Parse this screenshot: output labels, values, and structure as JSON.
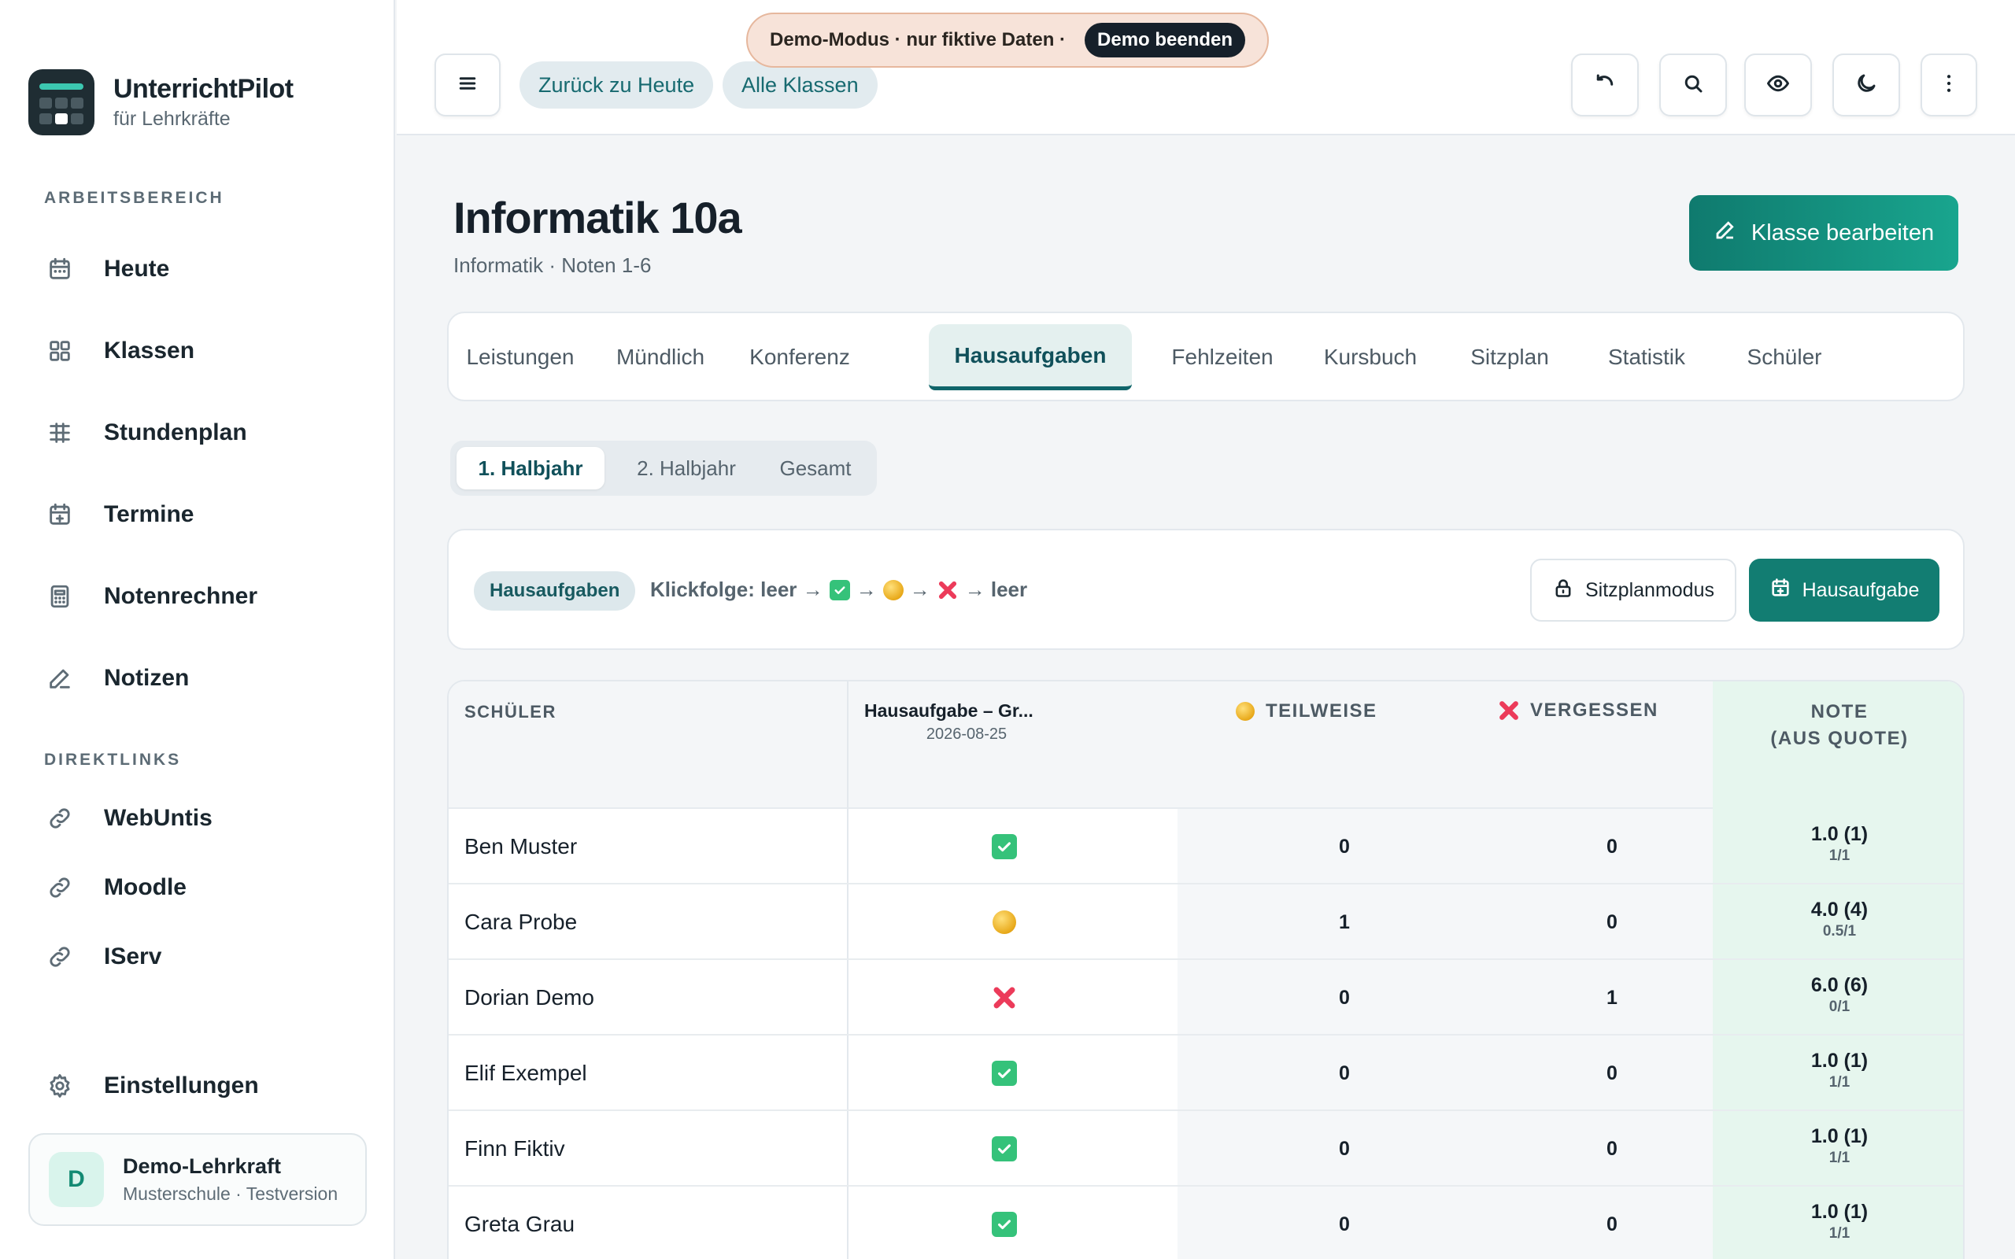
{
  "brand": {
    "title": "UnterrichtPilot",
    "subtitle": "für Lehrkräfte"
  },
  "sidebar": {
    "section_workspace": "ARBEITSBEREICH",
    "items": [
      {
        "label": "Heute",
        "icon": "calendar-icon"
      },
      {
        "label": "Klassen",
        "icon": "grid-icon"
      },
      {
        "label": "Stundenplan",
        "icon": "timetable-icon"
      },
      {
        "label": "Termine",
        "icon": "calendar-plus-icon"
      },
      {
        "label": "Notenrechner",
        "icon": "calculator-icon"
      },
      {
        "label": "Notizen",
        "icon": "pencil-icon"
      }
    ],
    "section_links": "DIREKTLINKS",
    "links": [
      {
        "label": "WebUntis",
        "icon": "link-icon"
      },
      {
        "label": "Moodle",
        "icon": "link-icon"
      },
      {
        "label": "IServ",
        "icon": "link-icon"
      }
    ],
    "settings_label": "Einstellungen",
    "profile": {
      "initial": "D",
      "name": "Demo-Lehrkraft",
      "sub": "Musterschule · Testversion"
    }
  },
  "topbar": {
    "demo_text": "Demo-Modus · nur fiktive Daten ·",
    "demo_stop": "Demo beenden",
    "back_today": "Zurück zu Heute",
    "all_classes": "Alle Klassen",
    "icons": [
      "menu-icon",
      "undo-icon",
      "search-icon",
      "eye-icon",
      "moon-icon",
      "more-vertical-icon"
    ]
  },
  "header": {
    "title": "Informatik 10a",
    "subtitle": "Informatik · Noten 1-6",
    "edit_button": "Klasse bearbeiten"
  },
  "tabs": [
    "Leistungen",
    "Mündlich",
    "Konferenz",
    "Hausaufgaben",
    "Fehlzeiten",
    "Kursbuch",
    "Sitzplan",
    "Statistik",
    "Schüler"
  ],
  "active_tab": "Hausaufgaben",
  "halves": [
    "1. Halbjahr",
    "2. Halbjahr",
    "Gesamt"
  ],
  "active_half": "1. Halbjahr",
  "toolbar": {
    "chip": "Hausaufgaben",
    "sequence_prefix": "Klickfolge: leer →",
    "arrow": "→",
    "sequence_end": "→ leer",
    "seating_mode": "Sitzplanmodus",
    "add_homework": "Hausaufgabe"
  },
  "table": {
    "col_student": "SCHÜLER",
    "col_assignment": "Hausaufgabe – Gr...",
    "col_assignment_date": "2026-08-25",
    "col_partial": "TEILWEISE",
    "col_forgotten": "VERGESSEN",
    "col_grade_line1": "NOTE",
    "col_grade_line2": "(AUS QUOTE)",
    "rows": [
      {
        "name": "Ben Muster",
        "status": "done",
        "partial": "0",
        "forgotten": "0",
        "grade": "1.0 (1)",
        "ratio": "1/1"
      },
      {
        "name": "Cara Probe",
        "status": "partial",
        "partial": "1",
        "forgotten": "0",
        "grade": "4.0 (4)",
        "ratio": "0.5/1"
      },
      {
        "name": "Dorian Demo",
        "status": "forgotten",
        "partial": "0",
        "forgotten": "1",
        "grade": "6.0 (6)",
        "ratio": "0/1"
      },
      {
        "name": "Elif Exempel",
        "status": "done",
        "partial": "0",
        "forgotten": "0",
        "grade": "1.0 (1)",
        "ratio": "1/1"
      },
      {
        "name": "Finn Fiktiv",
        "status": "done",
        "partial": "0",
        "forgotten": "0",
        "grade": "1.0 (1)",
        "ratio": "1/1"
      },
      {
        "name": "Greta Grau",
        "status": "done",
        "partial": "0",
        "forgotten": "0",
        "grade": "1.0 (1)",
        "ratio": "1/1"
      }
    ]
  }
}
